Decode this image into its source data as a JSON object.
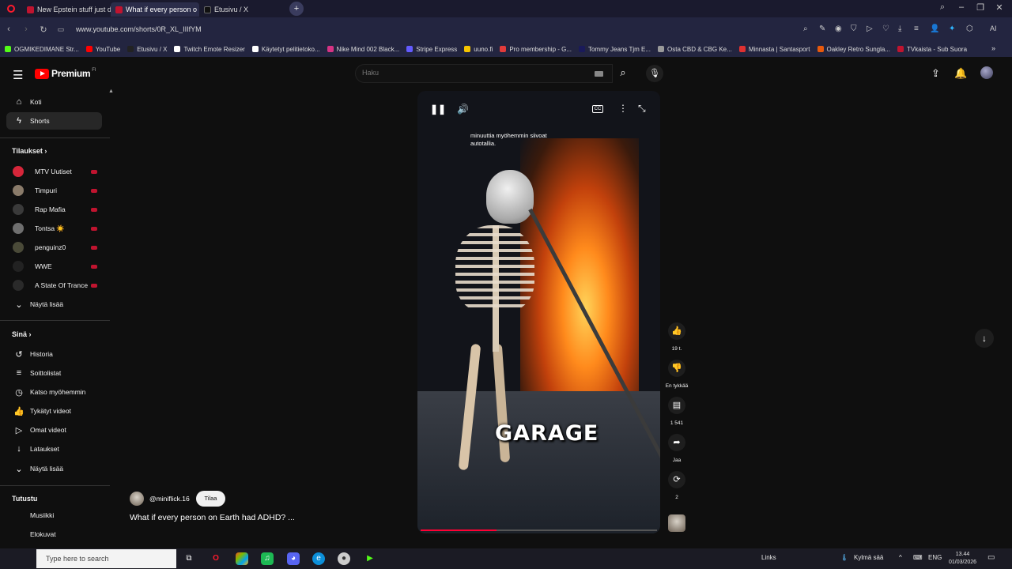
{
  "browser": {
    "tabs": [
      {
        "label": "New Epstein stuff just dro",
        "color": "#c0142f",
        "active": false
      },
      {
        "label": "What if every person o",
        "color": "#c0142f",
        "active": true
      },
      {
        "label": "Etusivu / X",
        "color": "#111111",
        "active": false
      }
    ],
    "new_tab": "+",
    "url": "www.youtube.com/shorts/0R_XL_IIIfYM",
    "bookmarks": [
      {
        "label": "OGMIKEDIMANE Str...",
        "color": "#53fc18"
      },
      {
        "label": "YouTube",
        "color": "#ff0000"
      },
      {
        "label": "Etusivu / X",
        "color": "#222222"
      },
      {
        "label": "Twitch Emote Resizer",
        "color": "#ffffff"
      },
      {
        "label": "Käytetyt pelitietoko...",
        "color": "#ffffff"
      },
      {
        "label": "Nike Mind 002 Black...",
        "color": "#d63384"
      },
      {
        "label": "Stripe Express",
        "color": "#635bff"
      },
      {
        "label": "uuno.fi",
        "color": "#f5c400"
      },
      {
        "label": "Pro membership - G...",
        "color": "#e23b3b"
      },
      {
        "label": "Tommy Jeans Tjm E...",
        "color": "#1a1a5a"
      },
      {
        "label": "Osta CBD & CBG Ke...",
        "color": "#9a9a9a"
      },
      {
        "label": "Minnasta | Santasport",
        "color": "#e03131"
      },
      {
        "label": "Oakley Retro Sungla...",
        "color": "#e8590c"
      },
      {
        "label": "TVkaista - Sub Suora",
        "color": "#c0142f"
      }
    ],
    "bookmarks_more": "»"
  },
  "youtube": {
    "logo_text": "Premium",
    "logo_country": "FI",
    "search_placeholder": "Haku",
    "sidebar": {
      "main": [
        {
          "label": "Koti",
          "icon": "⌂"
        },
        {
          "label": "Shorts",
          "icon": "ϟ"
        }
      ],
      "subscriptions_title": "Tilaukset",
      "subscriptions": [
        {
          "label": "MTV Uutiset",
          "color": "#d6263a"
        },
        {
          "label": "Timpuri",
          "color": "#8a7b6a"
        },
        {
          "label": "Rap Mafia",
          "color": "#3a3a3a"
        },
        {
          "label": "Tontsa ☀️",
          "color": "#6f6f6f"
        },
        {
          "label": "penguinz0",
          "color": "#4a4a38"
        },
        {
          "label": "WWE",
          "color": "#222222"
        },
        {
          "label": "A State Of Trance",
          "color": "#2a2a2a"
        }
      ],
      "show_more_1": "Näytä lisää",
      "you_title": "Sinä",
      "you_items": [
        {
          "label": "Historia",
          "icon": "↺"
        },
        {
          "label": "Soittolistat",
          "icon": "≡"
        },
        {
          "label": "Katso myöhemmin",
          "icon": "◷"
        },
        {
          "label": "Tykätyt videot",
          "icon": "👍"
        },
        {
          "label": "Omat videot",
          "icon": "▷"
        },
        {
          "label": "Lataukset",
          "icon": "↓"
        }
      ],
      "show_more_2": "Näytä lisää",
      "explore_title": "Tutustu",
      "explore_items": [
        {
          "label": "Musiikki"
        },
        {
          "label": "Elokuvat"
        }
      ]
    },
    "short": {
      "caption": "minuuttia myöhemmin siivoat autotallia.",
      "overlay_text": "GARAGE",
      "progress": 0.32,
      "channel_handle": "@miniflick.16",
      "subscribe_label": "Tilaa",
      "title": "What if every person on Earth had ADHD? ..."
    },
    "actions": {
      "likes": "19 t.",
      "dislike_label": "En tykkää",
      "comments": "1 541",
      "share_label": "Jaa",
      "remix_count": "2"
    }
  },
  "taskbar": {
    "search_placeholder": "Type here to search",
    "links_label": "Links",
    "weather": "Kylmä sää",
    "lang": "ENG",
    "time": "13.44",
    "date": "01/03/2026"
  }
}
